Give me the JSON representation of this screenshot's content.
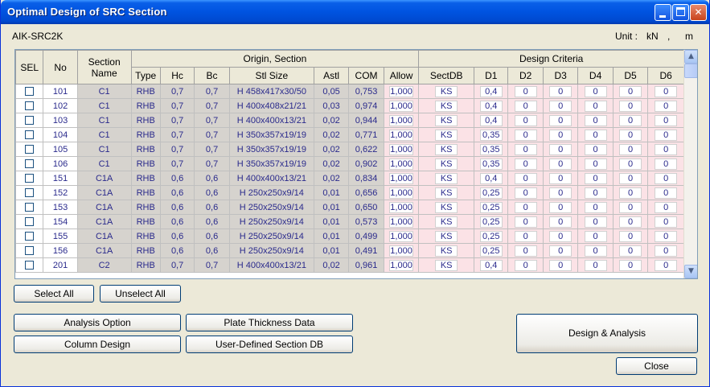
{
  "window": {
    "title": "Optimal Design of SRC Section"
  },
  "header": {
    "code": "AIK-SRC2K",
    "unit_label": "Unit :",
    "unit_force": "kN",
    "unit_sep": ",",
    "unit_length": "m"
  },
  "table": {
    "group_origin": "Origin, Section",
    "group_criteria": "Design Criteria",
    "col_sel": "SEL",
    "col_no": "No",
    "col_section_name": "Section Name",
    "columns": [
      "Type",
      "Hc",
      "Bc",
      "Stl Size",
      "Astl",
      "COM",
      "Allow",
      "SectDB",
      "D1",
      "D2",
      "D3",
      "D4",
      "D5",
      "D6"
    ],
    "rows": [
      {
        "no": "101",
        "name": "C1",
        "type": "RHB",
        "hc": "0,7",
        "bc": "0,7",
        "stl": "H 458x417x30/50",
        "astl": "0,05",
        "com": "0,753",
        "allow": "1,000",
        "sectdb": "KS",
        "d1": "0,4",
        "d2": "0",
        "d3": "0",
        "d4": "0",
        "d5": "0",
        "d6": "0"
      },
      {
        "no": "102",
        "name": "C1",
        "type": "RHB",
        "hc": "0,7",
        "bc": "0,7",
        "stl": "H 400x408x21/21",
        "astl": "0,03",
        "com": "0,974",
        "allow": "1,000",
        "sectdb": "KS",
        "d1": "0,4",
        "d2": "0",
        "d3": "0",
        "d4": "0",
        "d5": "0",
        "d6": "0"
      },
      {
        "no": "103",
        "name": "C1",
        "type": "RHB",
        "hc": "0,7",
        "bc": "0,7",
        "stl": "H 400x400x13/21",
        "astl": "0,02",
        "com": "0,944",
        "allow": "1,000",
        "sectdb": "KS",
        "d1": "0,4",
        "d2": "0",
        "d3": "0",
        "d4": "0",
        "d5": "0",
        "d6": "0"
      },
      {
        "no": "104",
        "name": "C1",
        "type": "RHB",
        "hc": "0,7",
        "bc": "0,7",
        "stl": "H 350x357x19/19",
        "astl": "0,02",
        "com": "0,771",
        "allow": "1,000",
        "sectdb": "KS",
        "d1": "0,35",
        "d2": "0",
        "d3": "0",
        "d4": "0",
        "d5": "0",
        "d6": "0"
      },
      {
        "no": "105",
        "name": "C1",
        "type": "RHB",
        "hc": "0,7",
        "bc": "0,7",
        "stl": "H 350x357x19/19",
        "astl": "0,02",
        "com": "0,622",
        "allow": "1,000",
        "sectdb": "KS",
        "d1": "0,35",
        "d2": "0",
        "d3": "0",
        "d4": "0",
        "d5": "0",
        "d6": "0"
      },
      {
        "no": "106",
        "name": "C1",
        "type": "RHB",
        "hc": "0,7",
        "bc": "0,7",
        "stl": "H 350x357x19/19",
        "astl": "0,02",
        "com": "0,902",
        "allow": "1,000",
        "sectdb": "KS",
        "d1": "0,35",
        "d2": "0",
        "d3": "0",
        "d4": "0",
        "d5": "0",
        "d6": "0"
      },
      {
        "no": "151",
        "name": "C1A",
        "type": "RHB",
        "hc": "0,6",
        "bc": "0,6",
        "stl": "H 400x400x13/21",
        "astl": "0,02",
        "com": "0,834",
        "allow": "1,000",
        "sectdb": "KS",
        "d1": "0,4",
        "d2": "0",
        "d3": "0",
        "d4": "0",
        "d5": "0",
        "d6": "0"
      },
      {
        "no": "152",
        "name": "C1A",
        "type": "RHB",
        "hc": "0,6",
        "bc": "0,6",
        "stl": "H 250x250x9/14",
        "astl": "0,01",
        "com": "0,656",
        "allow": "1,000",
        "sectdb": "KS",
        "d1": "0,25",
        "d2": "0",
        "d3": "0",
        "d4": "0",
        "d5": "0",
        "d6": "0"
      },
      {
        "no": "153",
        "name": "C1A",
        "type": "RHB",
        "hc": "0,6",
        "bc": "0,6",
        "stl": "H 250x250x9/14",
        "astl": "0,01",
        "com": "0,650",
        "allow": "1,000",
        "sectdb": "KS",
        "d1": "0,25",
        "d2": "0",
        "d3": "0",
        "d4": "0",
        "d5": "0",
        "d6": "0"
      },
      {
        "no": "154",
        "name": "C1A",
        "type": "RHB",
        "hc": "0,6",
        "bc": "0,6",
        "stl": "H 250x250x9/14",
        "astl": "0,01",
        "com": "0,573",
        "allow": "1,000",
        "sectdb": "KS",
        "d1": "0,25",
        "d2": "0",
        "d3": "0",
        "d4": "0",
        "d5": "0",
        "d6": "0"
      },
      {
        "no": "155",
        "name": "C1A",
        "type": "RHB",
        "hc": "0,6",
        "bc": "0,6",
        "stl": "H 250x250x9/14",
        "astl": "0,01",
        "com": "0,499",
        "allow": "1,000",
        "sectdb": "KS",
        "d1": "0,25",
        "d2": "0",
        "d3": "0",
        "d4": "0",
        "d5": "0",
        "d6": "0"
      },
      {
        "no": "156",
        "name": "C1A",
        "type": "RHB",
        "hc": "0,6",
        "bc": "0,6",
        "stl": "H 250x250x9/14",
        "astl": "0,01",
        "com": "0,491",
        "allow": "1,000",
        "sectdb": "KS",
        "d1": "0,25",
        "d2": "0",
        "d3": "0",
        "d4": "0",
        "d5": "0",
        "d6": "0"
      },
      {
        "no": "201",
        "name": "C2",
        "type": "RHB",
        "hc": "0,7",
        "bc": "0,7",
        "stl": "H 400x400x13/21",
        "astl": "0,02",
        "com": "0,961",
        "allow": "1,000",
        "sectdb": "KS",
        "d1": "0,4",
        "d2": "0",
        "d3": "0",
        "d4": "0",
        "d5": "0",
        "d6": "0"
      }
    ]
  },
  "buttons": {
    "select_all": "Select All",
    "unselect_all": "Unselect All",
    "analysis_option": "Analysis Option",
    "plate_thickness": "Plate Thickness Data",
    "column_design": "Column Design",
    "user_defined_db": "User-Defined Section DB",
    "design_analysis": "Design & Analysis",
    "close": "Close"
  },
  "icons": {
    "minimize": "minimize-icon",
    "maximize": "maximize-icon",
    "close": "close-icon",
    "scroll_up": "arrow-up-icon",
    "scroll_down": "arrow-down-icon"
  }
}
